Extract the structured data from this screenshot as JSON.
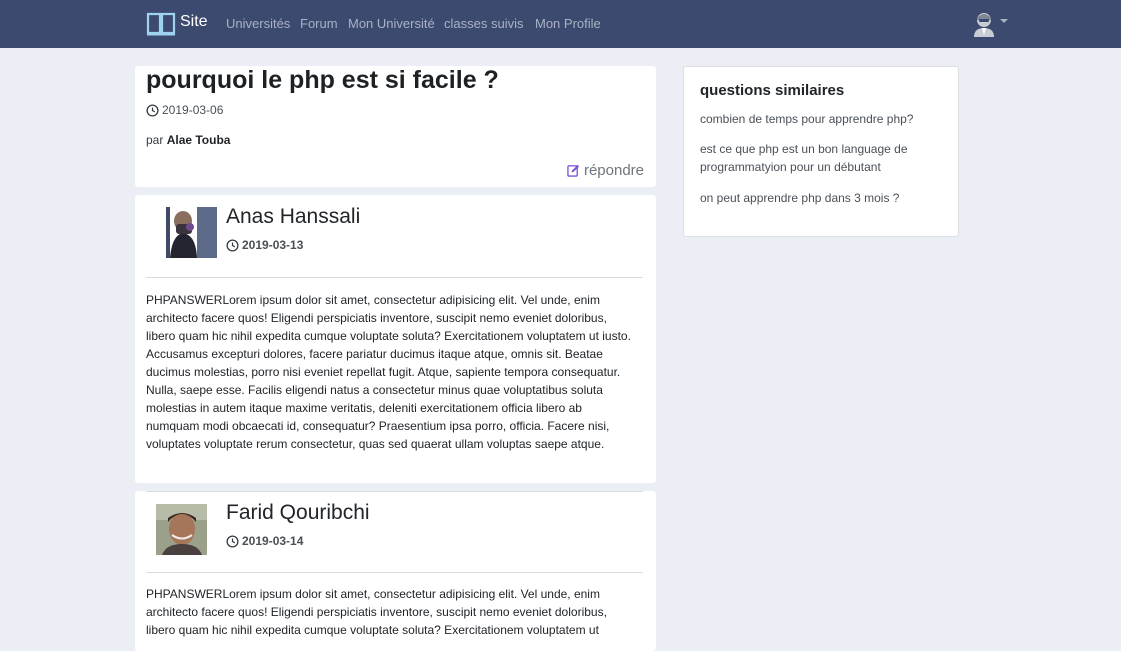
{
  "navbar": {
    "brand": "Site",
    "links": [
      "Universités",
      "Forum",
      "Mon Université",
      "classes suivis",
      "Mon Profile"
    ]
  },
  "question": {
    "title": "pourquoi le php est si facile ?",
    "date": "2019-03-06",
    "author_prefix": "par",
    "author": "Alae Touba",
    "reply_label": "répondre"
  },
  "answers": [
    {
      "name": "Anas Hanssali",
      "date": "2019-03-13",
      "text": "PHPANSWERLorem ipsum dolor sit amet, consectetur adipisicing elit. Vel unde, enim architecto facere quos! Eligendi perspiciatis inventore, suscipit nemo eveniet doloribus, libero quam hic nihil expedita cumque voluptate soluta? Exercitationem voluptatem ut iusto. Accusamus excepturi dolores, facere pariatur ducimus itaque atque, omnis sit. Beatae ducimus molestias, porro nisi eveniet repellat fugit. Atque, sapiente tempora consequatur. Nulla, saepe esse. Facilis eligendi natus a consectetur minus quae voluptatibus soluta molestias in autem itaque maxime veritatis, deleniti exercitationem officia libero ab numquam modi obcaecati id, consequatur? Praesentium ipsa porro, officia. Facere nisi, voluptates voluptate rerum consectetur, quas sed quaerat ullam voluptas saepe atque."
    },
    {
      "name": "Farid Qouribchi",
      "date": "2019-03-14",
      "text": "PHPANSWERLorem ipsum dolor sit amet, consectetur adipisicing elit. Vel unde, enim architecto facere quos! Eligendi perspiciatis inventore, suscipit nemo eveniet doloribus, libero quam hic nihil expedita cumque voluptate soluta? Exercitationem voluptatem ut"
    }
  ],
  "sidebar": {
    "title": "questions similaires",
    "links": [
      "combien de temps pour apprendre php?",
      "est ce que php est un bon language de programmatyion pour un débutant",
      "on peut apprendre php dans 3 mois ?"
    ]
  },
  "colors": {
    "navbar": "#3b4a6e",
    "background": "#eceef6",
    "reply_icon": "#7b4fd6"
  },
  "icons": [
    "book-icon",
    "user-avatar-icon",
    "clock-icon",
    "edit-icon"
  ]
}
